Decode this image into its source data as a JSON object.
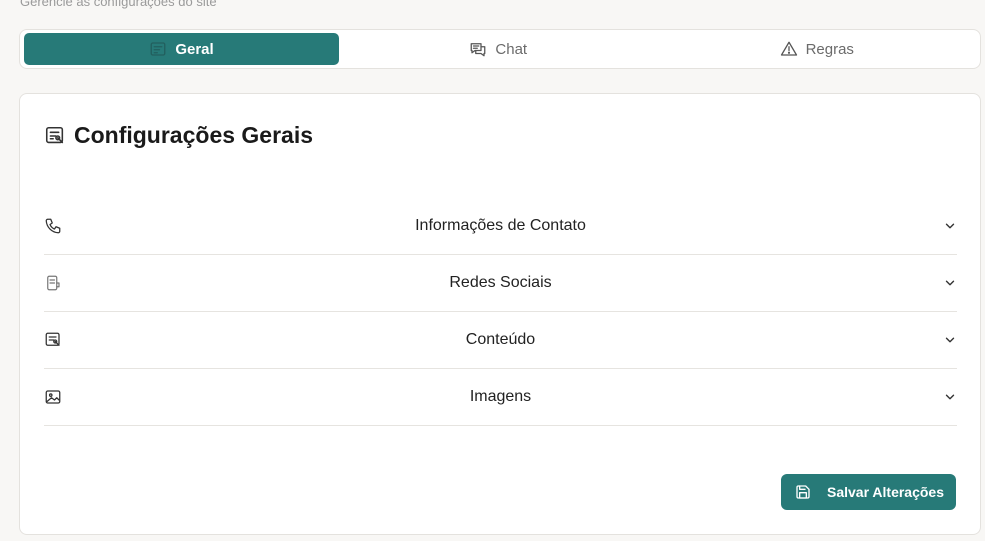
{
  "header": {
    "clipped_subtitle": "Gerencie as configurações do site"
  },
  "tabs": [
    {
      "label": "Geral",
      "icon": "form-icon",
      "active": true
    },
    {
      "label": "Chat",
      "icon": "chat-icon",
      "active": false
    },
    {
      "label": "Regras",
      "icon": "warning-icon",
      "active": false
    }
  ],
  "card": {
    "title": "Configurações Gerais",
    "title_icon": "form-icon",
    "sections": [
      {
        "label": "Informações de Contato",
        "icon": "phone-icon"
      },
      {
        "label": "Redes Sociais",
        "icon": "social-icon"
      },
      {
        "label": "Conteúdo",
        "icon": "content-icon"
      },
      {
        "label": "Imagens",
        "icon": "image-icon"
      }
    ],
    "save_label": "Salvar Alterações"
  },
  "colors": {
    "accent": "#277a78",
    "background": "#f8f7f5",
    "border": "#e4e2de"
  }
}
